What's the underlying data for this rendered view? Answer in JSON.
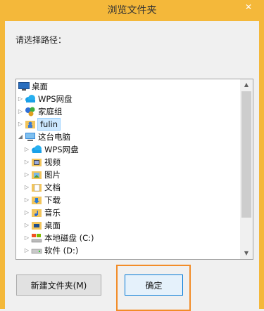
{
  "window": {
    "title": "浏览文件夹",
    "close_glyph": "✕",
    "frame_color": "#f4b83a"
  },
  "prompt": "请选择路径：",
  "tree": {
    "items": [
      {
        "label": "桌面",
        "icon": "desktop-icon",
        "expander": ""
      },
      {
        "label": "WPS网盘",
        "icon": "cloud-icon",
        "expander": "▷"
      },
      {
        "label": "家庭组",
        "icon": "homegroup-icon",
        "expander": "▷"
      },
      {
        "label": "fulin",
        "icon": "user-folder-icon",
        "expander": "▷",
        "selected": true
      },
      {
        "label": "这台电脑",
        "icon": "computer-icon",
        "expander": "◢"
      },
      {
        "label": "WPS网盘",
        "icon": "cloud-icon",
        "expander": "▷"
      },
      {
        "label": "视频",
        "icon": "video-folder-icon",
        "expander": "▷"
      },
      {
        "label": "图片",
        "icon": "pictures-folder-icon",
        "expander": "▷"
      },
      {
        "label": "文档",
        "icon": "documents-folder-icon",
        "expander": "▷"
      },
      {
        "label": "下载",
        "icon": "downloads-folder-icon",
        "expander": "▷"
      },
      {
        "label": "音乐",
        "icon": "music-folder-icon",
        "expander": "▷"
      },
      {
        "label": "桌面",
        "icon": "desktop-folder-icon",
        "expander": "▷"
      },
      {
        "label": "本地磁盘 (C:)",
        "icon": "system-drive-icon",
        "expander": "▷"
      },
      {
        "label": "软件 (D:)",
        "icon": "drive-icon",
        "expander": "▷"
      }
    ],
    "scroll_up": "▲",
    "scroll_down": "▼"
  },
  "buttons": {
    "new_folder": "新建文件夹(M)",
    "ok": "确定"
  }
}
